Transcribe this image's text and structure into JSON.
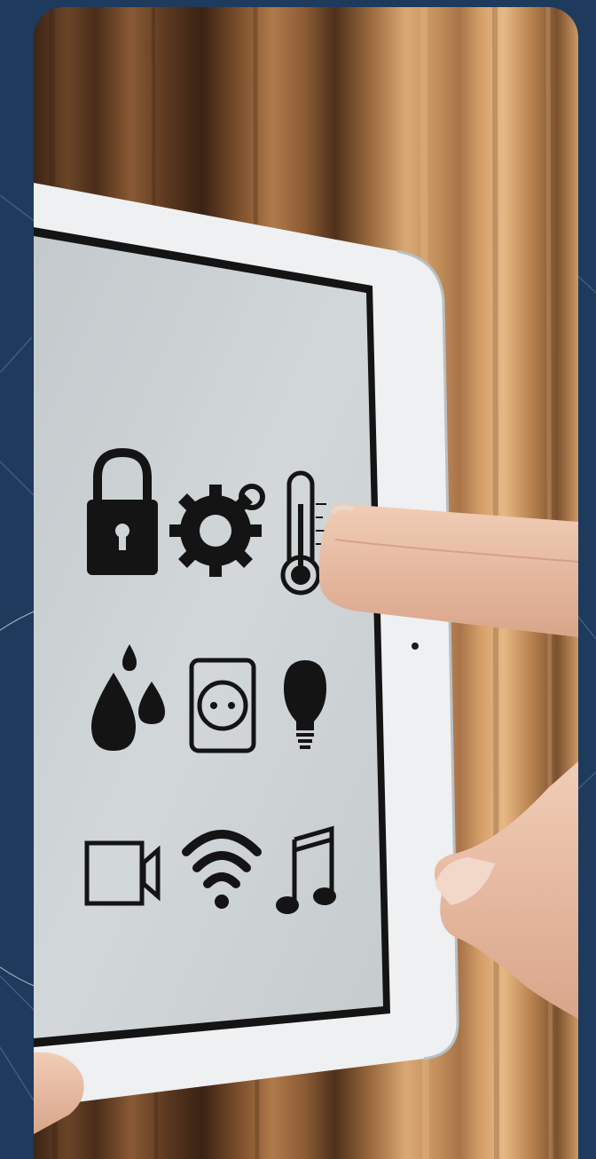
{
  "scene": {
    "subject": "tablet-smart-home-controls",
    "background_color": "#1e3a5c",
    "frame_color": "#eef0f1",
    "screen_color": "#cfd4d6",
    "icon_color": "#141414",
    "icons": [
      "lock-icon",
      "gear-icon",
      "thermometer-icon",
      "water-drop-icon",
      "power-socket-icon",
      "light-bulb-icon",
      "video-camera-icon",
      "wifi-icon",
      "music-note-icon"
    ]
  }
}
